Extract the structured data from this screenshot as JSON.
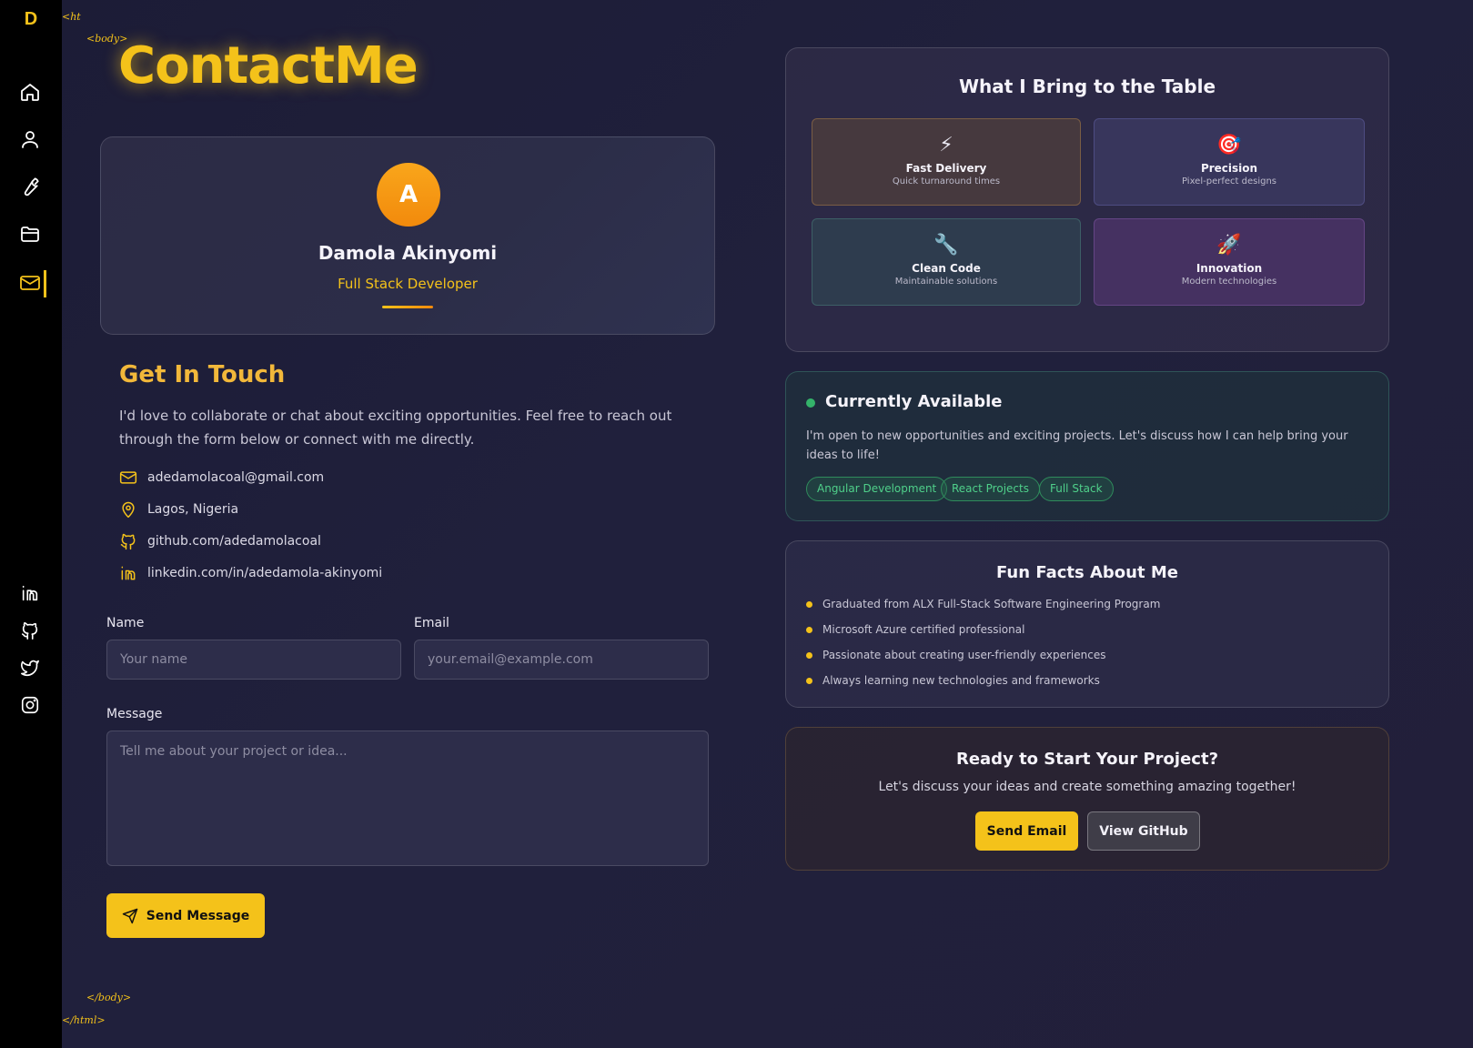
{
  "sidebar": {
    "logo": "D",
    "nav": [
      "home-icon",
      "user-icon",
      "wrench-icon",
      "folder-icon",
      "mail-icon"
    ],
    "social": [
      "linkedin-icon",
      "github-icon",
      "twitter-icon",
      "instagram-icon"
    ]
  },
  "tags": {
    "html_open": "<ht",
    "body_open": "<body>",
    "body_close": "</body>",
    "html_close": "</html>"
  },
  "page": {
    "title": "ContactMe"
  },
  "profile": {
    "initial": "A",
    "name": "Damola Akinyomi",
    "role": "Full Stack Developer"
  },
  "touch": {
    "heading": "Get In Touch",
    "text": "I'd love to collaborate or chat about exciting opportunities. Feel free to reach out through the form below or connect with me directly.",
    "email": "adedamolacoal@gmail.com",
    "location": "Lagos, Nigeria",
    "github": "github.com/adedamolacoal",
    "linkedin": "linkedin.com/in/adedamola-akinyomi"
  },
  "form": {
    "name_label": "Name",
    "name_placeholder": "Your name",
    "email_label": "Email",
    "email_placeholder": "your.email@example.com",
    "message_label": "Message",
    "message_placeholder": "Tell me about your project or idea...",
    "submit_label": "Send Message"
  },
  "bring": {
    "heading": "What I Bring to the Table",
    "features": [
      {
        "emoji": "⚡",
        "title": "Fast Delivery",
        "subtitle": "Quick turnaround times"
      },
      {
        "emoji": "🎯",
        "title": "Precision",
        "subtitle": "Pixel-perfect designs"
      },
      {
        "emoji": "🔧",
        "title": "Clean Code",
        "subtitle": "Maintainable solutions"
      },
      {
        "emoji": "🚀",
        "title": "Innovation",
        "subtitle": "Modern technologies"
      }
    ]
  },
  "availability": {
    "heading": "Currently Available",
    "text": "I'm open to new opportunities and exciting projects. Let's discuss how I can help bring your ideas to life!",
    "tags": [
      "Angular Development",
      "React Projects",
      "Full Stack"
    ]
  },
  "facts": {
    "heading": "Fun Facts About Me",
    "items": [
      "Graduated from ALX Full-Stack Software Engineering Program",
      "Microsoft Azure certified professional",
      "Passionate about creating user-friendly experiences",
      "Always learning new technologies and frameworks"
    ]
  },
  "ready": {
    "heading": "Ready to Start Your Project?",
    "text": "Let's discuss your ideas and create something amazing together!",
    "primary_label": "Send Email",
    "secondary_label": "View GitHub"
  },
  "colors": {
    "accent": "#f4c21a",
    "background": "#1e1d38",
    "sidebar": "#000000",
    "available": "#34b36a"
  }
}
